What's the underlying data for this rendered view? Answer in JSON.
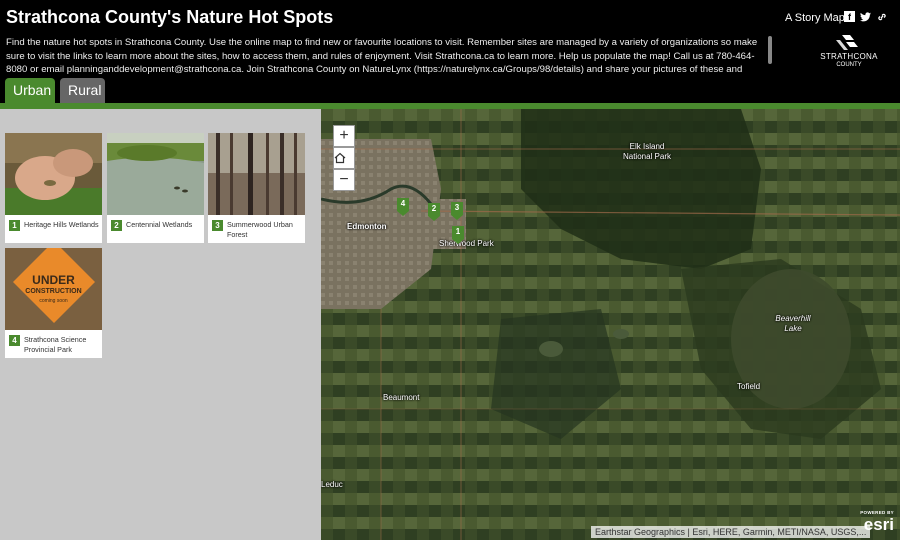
{
  "header": {
    "title": "Strathcona County's Nature Hot Spots",
    "description": "Find the nature hot spots in Strathcona County. Use the online map to find new or favourite locations to visit. Remember sites are managed by a variety of organizations so make sure to visit the links to learn more about the sites, how to access them, and rules of enjoyment. Visit Strathcona.ca to learn more. Help us populate the map! Call us at 780-464-8080 or email planninganddevelopment@strathcona.ca. Join Strathcona County on NatureLynx (https://naturelynx.ca/Groups/98/details) and share your pictures of these and other nature hot spots in",
    "story_map_label": "A Story Map",
    "logo_line1": "STRATHCONA",
    "logo_line2": "COUNTY"
  },
  "tabs": [
    {
      "label": "Urban",
      "active": true
    },
    {
      "label": "Rural",
      "active": false
    }
  ],
  "cards": [
    {
      "number": "1",
      "title": "Heritage Hills Wetlands"
    },
    {
      "number": "2",
      "title": "Centennial Wetlands"
    },
    {
      "number": "3",
      "title": "Summerwood Urban Forest"
    },
    {
      "number": "4",
      "title": "Strathcona Science Provincial Park",
      "image_text_1": "UNDER",
      "image_text_2": "CONSTRUCTION",
      "image_text_3": "coming soon"
    }
  ],
  "map": {
    "zoom_in": "+",
    "zoom_out": "−",
    "labels": {
      "elk_island": "Elk Island National Park",
      "edmonton": "Edmonton",
      "sherwood_park": "Sherwood Park",
      "beaverhill": "Beaverhill Lake",
      "tofield": "Tofield",
      "beaumont": "Beaumont",
      "leduc": "Leduc"
    },
    "pins": [
      "4",
      "2",
      "3",
      "1"
    ],
    "attribution": "Earthstar Geographics | Esri, HERE, Garmin, METI/NASA, USGS,...",
    "esri_powered": "POWERED BY",
    "esri_logo": "esri"
  },
  "colors": {
    "accent_green": "#4a8a2e",
    "inactive_tab": "#666666"
  }
}
